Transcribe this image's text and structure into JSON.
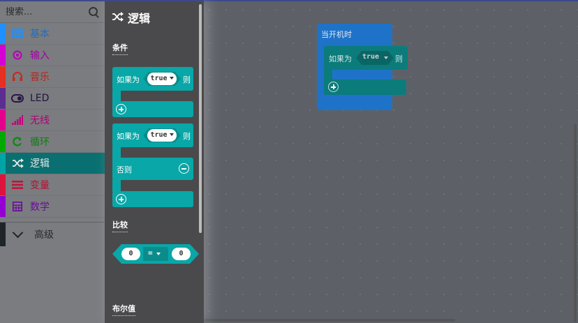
{
  "search": {
    "placeholder": "搜索..."
  },
  "categories": [
    {
      "label": "基本",
      "color": "#1e90ff",
      "icon": "grid-icon"
    },
    {
      "label": "输入",
      "color": "#d400d4",
      "icon": "radio-target-icon"
    },
    {
      "label": "音乐",
      "color": "#e63022",
      "icon": "headphones-icon"
    },
    {
      "label": "LED",
      "color": "#5c2d91",
      "icon": "toggle-icon"
    },
    {
      "label": "无线",
      "color": "#e3008c",
      "icon": "signal-bars-icon"
    },
    {
      "label": "循环",
      "color": "#00aa00",
      "icon": "refresh-icon"
    },
    {
      "label": "逻辑",
      "color": "#00a4a6",
      "icon": "shuffle-icon"
    },
    {
      "label": "变量",
      "color": "#dc143c",
      "icon": "lines-icon"
    },
    {
      "label": "数学",
      "color": "#9400d3",
      "icon": "calculator-icon"
    }
  ],
  "advanced": {
    "label": "高级"
  },
  "flyout": {
    "title": "逻辑",
    "sections": {
      "conditions": "条件",
      "comparison": "比较",
      "boolean": "布尔值"
    },
    "if_block": {
      "if_label": "如果为",
      "value": "true",
      "then_label": "则"
    },
    "if_else_block": {
      "if_label": "如果为",
      "value": "true",
      "then_label": "则",
      "else_label": "否则"
    },
    "compare_block": {
      "left": "0",
      "op": "=",
      "right": "0"
    }
  },
  "workspace": {
    "on_start": {
      "label": "当开机时"
    },
    "if_block": {
      "if_label": "如果为",
      "value": "true",
      "then_label": "则"
    }
  },
  "colors": {
    "logic": "#00a4a6",
    "basic": "#1e90ff"
  }
}
